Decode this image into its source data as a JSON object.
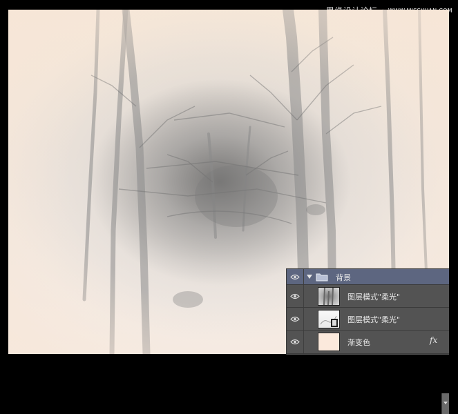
{
  "watermark": {
    "site_name": "思缘设计论坛",
    "separator": "·",
    "url": "WWW.MISSYUAN.COM"
  },
  "layers_panel": {
    "group": {
      "name": "背景",
      "expanded": true,
      "visible": true
    },
    "layers": [
      {
        "name": "图层模式\"柔光\"",
        "visible": true,
        "thumbnail": "forest-photo"
      },
      {
        "name": "图层模式\"柔光\"",
        "visible": true,
        "thumbnail": "texture-with-mask"
      },
      {
        "name": "渐变色",
        "visible": true,
        "thumbnail": "peach-fill",
        "effect_label": "fx"
      }
    ]
  },
  "colors": {
    "panel_bg": "#535353",
    "group_highlight": "#5d6680",
    "gradient_fill": "#fbe9dc"
  }
}
